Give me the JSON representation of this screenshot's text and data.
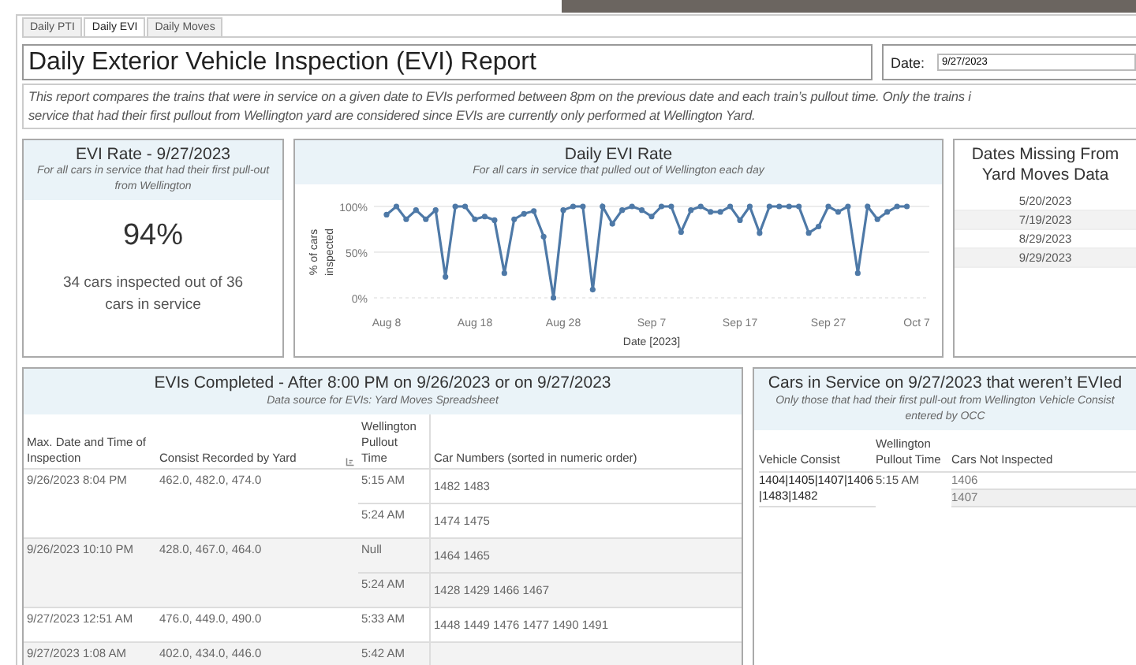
{
  "tabs": [
    {
      "label": "Daily PTI",
      "selected": false
    },
    {
      "label": "Daily EVI",
      "selected": true
    },
    {
      "label": "Daily Moves",
      "selected": false
    }
  ],
  "title": "Daily Exterior Vehicle Inspection (EVI) Report",
  "date_filter": {
    "label": "Date:",
    "value": "9/27/2023"
  },
  "description": [
    "This report compares the trains that were in service on a given date to EVIs performed between 8pm on the previous date and each train’s pullout time. Only the trains i",
    "service that had their first pullout from Wellington yard are considered since EVIs are currently only performed at Wellington Yard."
  ],
  "evi_rate": {
    "title": "EVI Rate - 9/27/2023",
    "subtitle": "For all cars in service that had their first pull-out from Wellington",
    "value": "94%",
    "detail": "34 cars inspected out of 36 cars in service"
  },
  "daily_chart": {
    "title": "Daily EVI Rate",
    "subtitle": "For all cars in service that pulled out of Wellington each day",
    "chart_data": {
      "type": "line",
      "xlabel": "Date [2023]",
      "ylabel": "% of cars inspected",
      "categories": [
        "Aug 8",
        null,
        null,
        null,
        null,
        null,
        null,
        null,
        null,
        "Aug 18",
        null,
        null,
        null,
        null,
        null,
        null,
        null,
        null,
        "Aug 28",
        null,
        null,
        null,
        null,
        null,
        null,
        null,
        null,
        "Sep 7",
        null,
        null,
        null,
        null,
        null,
        null,
        null,
        null,
        "Sep 17",
        null,
        null,
        null,
        null,
        null,
        null,
        null,
        null,
        "Sep 27",
        null,
        null,
        null,
        null,
        null,
        null,
        null,
        null,
        "Oct 7"
      ],
      "series": [
        {
          "color": "#4e79a7",
          "marker": true,
          "values": [
            91,
            100,
            86,
            96,
            86,
            96,
            23,
            100,
            100,
            86,
            89,
            85,
            27,
            86,
            92,
            95,
            67,
            0,
            96,
            100,
            100,
            9,
            100,
            81,
            96,
            100,
            96,
            89,
            100,
            100,
            72,
            96,
            100,
            94,
            94,
            100,
            85,
            100,
            71,
            100,
            100,
            100,
            100,
            71,
            78,
            100,
            94,
            100,
            27,
            100,
            86,
            94,
            100,
            100,
            null
          ]
        }
      ],
      "ylim": [
        0,
        100
      ],
      "yticks": [
        {
          "value": 0,
          "label": "0%"
        },
        {
          "value": 50,
          "label": "50%"
        },
        {
          "value": 100,
          "label": "100%"
        }
      ]
    }
  },
  "missing_dates": {
    "title": "Dates Missing From Yard Moves Data",
    "dates": [
      "5/20/2023",
      "7/19/2023",
      "8/29/2023",
      "9/29/2023"
    ]
  },
  "evis_completed": {
    "title": "EVIs Completed - After 8:00 PM on 9/26/2023 or on 9/27/2023",
    "subtitle": "Data source for EVIs: Yard Moves Spreadsheet",
    "columns": [
      "Max. Date and Time of Inspection",
      "Consist Recorded by Yard",
      "Wellington Pullout Time",
      "Car Numbers (sorted in numeric order)"
    ],
    "rows": [
      {
        "inspected": "9/26/2023 8:04 PM",
        "consist": "462.0, 482.0, 474.0",
        "pullouts": [
          {
            "time": "5:15 AM",
            "cars": "1482  1483"
          },
          {
            "time": "5:24 AM",
            "cars": "1474  1475"
          }
        ]
      },
      {
        "inspected": "9/26/2023 10:10 PM",
        "consist": "428.0, 467.0, 464.0",
        "pullouts": [
          {
            "time": "Null",
            "cars": "1464  1465"
          },
          {
            "time": "5:24 AM",
            "cars": "1428  1429  1466  1467"
          }
        ]
      },
      {
        "inspected": "9/27/2023 12:51 AM",
        "consist": "476.0, 449.0, 490.0",
        "pullouts": [
          {
            "time": "5:33 AM",
            "cars": "1448  1449  1476  1477  1490  1491"
          }
        ]
      },
      {
        "inspected": "9/27/2023 1:08 AM",
        "consist": "402.0, 434.0, 446.0",
        "pullouts": [
          {
            "time": "5:42 AM"
          }
        ]
      }
    ]
  },
  "not_evied": {
    "title": "Cars in Service on 9/27/2023 that weren’t EVIed",
    "subtitle": "Only those that had their first pull-out from Wellington Vehicle Consist entered by OCC",
    "columns": [
      "Vehicle Consist",
      "Wellington Pullout Time",
      "Cars Not Inspected"
    ],
    "rows": [
      {
        "consist": "1404|1405|1407|1406|1483|1482",
        "time": "5:15 AM",
        "cars": [
          "1406",
          "1407"
        ]
      }
    ]
  }
}
